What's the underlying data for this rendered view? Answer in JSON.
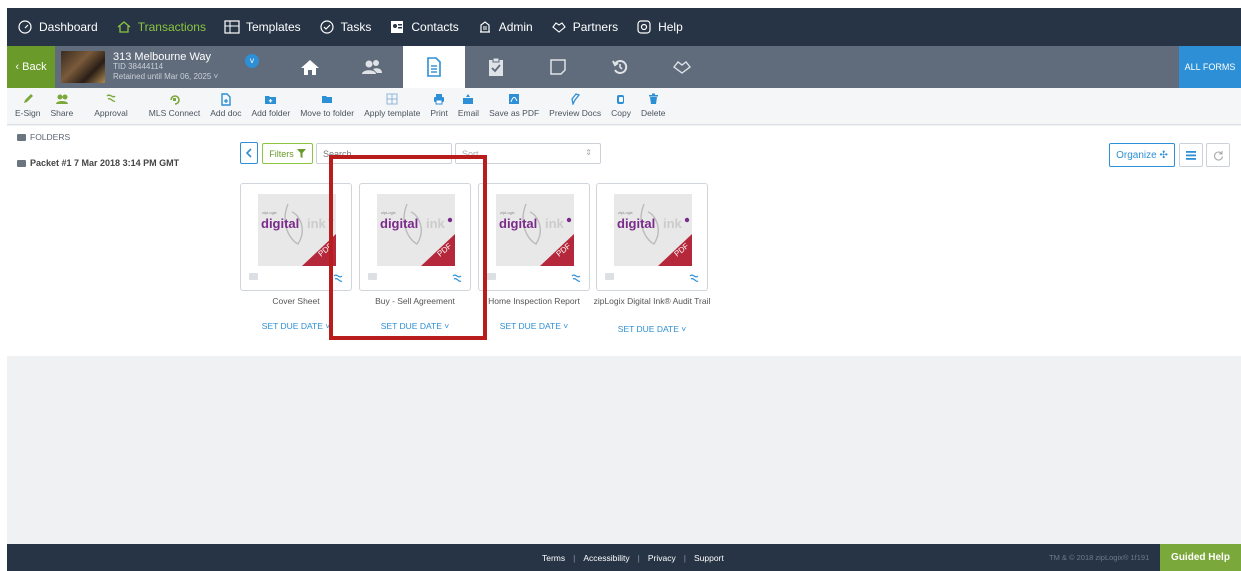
{
  "colors": {
    "nav_bg": "#263445",
    "accent_green": "#8cc63f",
    "accent_blue": "#2d8fd5",
    "highlight": "#b91c1c",
    "pdf_red": "#b5283b",
    "brand_purple": "#7a2a8a"
  },
  "topnav": {
    "items": [
      {
        "label": "Dashboard",
        "icon": "gauge-icon"
      },
      {
        "label": "Transactions",
        "icon": "house-icon",
        "active": true
      },
      {
        "label": "Templates",
        "icon": "grid-icon"
      },
      {
        "label": "Tasks",
        "icon": "check-circle-icon"
      },
      {
        "label": "Contacts",
        "icon": "contact-card-icon"
      },
      {
        "label": "Admin",
        "icon": "building-icon"
      },
      {
        "label": "Partners",
        "icon": "handshake-icon"
      },
      {
        "label": "Help",
        "icon": "lifebuoy-icon"
      }
    ]
  },
  "transaction": {
    "back_label": "‹ Back",
    "address": "313 Melbourne Way",
    "tid": "TID 38444114",
    "retained": "Retained until Mar 06, 2025 ˅",
    "tabs": [
      "home-icon",
      "people-icon",
      "document-icon",
      "checklist-icon",
      "note-icon",
      "history-icon",
      "handshake-icon"
    ],
    "all_forms": "ALL FORMS"
  },
  "toolbar": {
    "items": [
      {
        "label": "E-Sign",
        "icon": "pen-icon"
      },
      {
        "label": "Share",
        "icon": "share-people-icon"
      },
      {
        "label": "Approval",
        "icon": "approval-icon"
      },
      {
        "label": "MLS Connect",
        "icon": "mls-connect-icon"
      },
      {
        "label": "Add doc",
        "icon": "add-doc-icon"
      },
      {
        "label": "Add folder",
        "icon": "add-folder-icon"
      },
      {
        "label": "Move to folder",
        "icon": "move-folder-icon"
      },
      {
        "label": "Apply template",
        "icon": "template-icon"
      },
      {
        "label": "Print",
        "icon": "print-icon"
      },
      {
        "label": "Email",
        "icon": "email-icon"
      },
      {
        "label": "Save as PDF",
        "icon": "pdf-icon"
      },
      {
        "label": "Preview Docs",
        "icon": "preview-icon"
      },
      {
        "label": "Copy",
        "icon": "copy-icon"
      },
      {
        "label": "Delete",
        "icon": "trash-icon"
      }
    ]
  },
  "sidebar": {
    "folders_heading": "FOLDERS",
    "packet": "Packet #1 7 Mar 2018 3:14 PM GMT"
  },
  "filterbar": {
    "filters_label": "Filters",
    "search_placeholder": "Search...",
    "sort_placeholder": "Sort..."
  },
  "documents": [
    {
      "name": "Cover Sheet",
      "due": "SET DUE DATE ˅"
    },
    {
      "name": "Buy - Sell Agreement",
      "due": "SET DUE DATE ˅"
    },
    {
      "name": "Home Inspection Report",
      "due": "SET DUE DATE ˅"
    },
    {
      "name": "zipLogix Digital Ink® Audit Trail",
      "due": "SET DUE DATE ˅"
    }
  ],
  "doc_art": {
    "brand": "digitalink",
    "brand_lead": "digital",
    "brand_tail": "ink",
    "small": "zipLogix",
    "pdf": "PDF"
  },
  "actions": {
    "organize_label": "Organize ✣"
  },
  "footer": {
    "links": [
      "Terms",
      "Accessibility",
      "Privacy",
      "Support"
    ],
    "copyright": "TM & © 2018 zipLogix® 1f191",
    "guided_help": "Guided Help"
  }
}
